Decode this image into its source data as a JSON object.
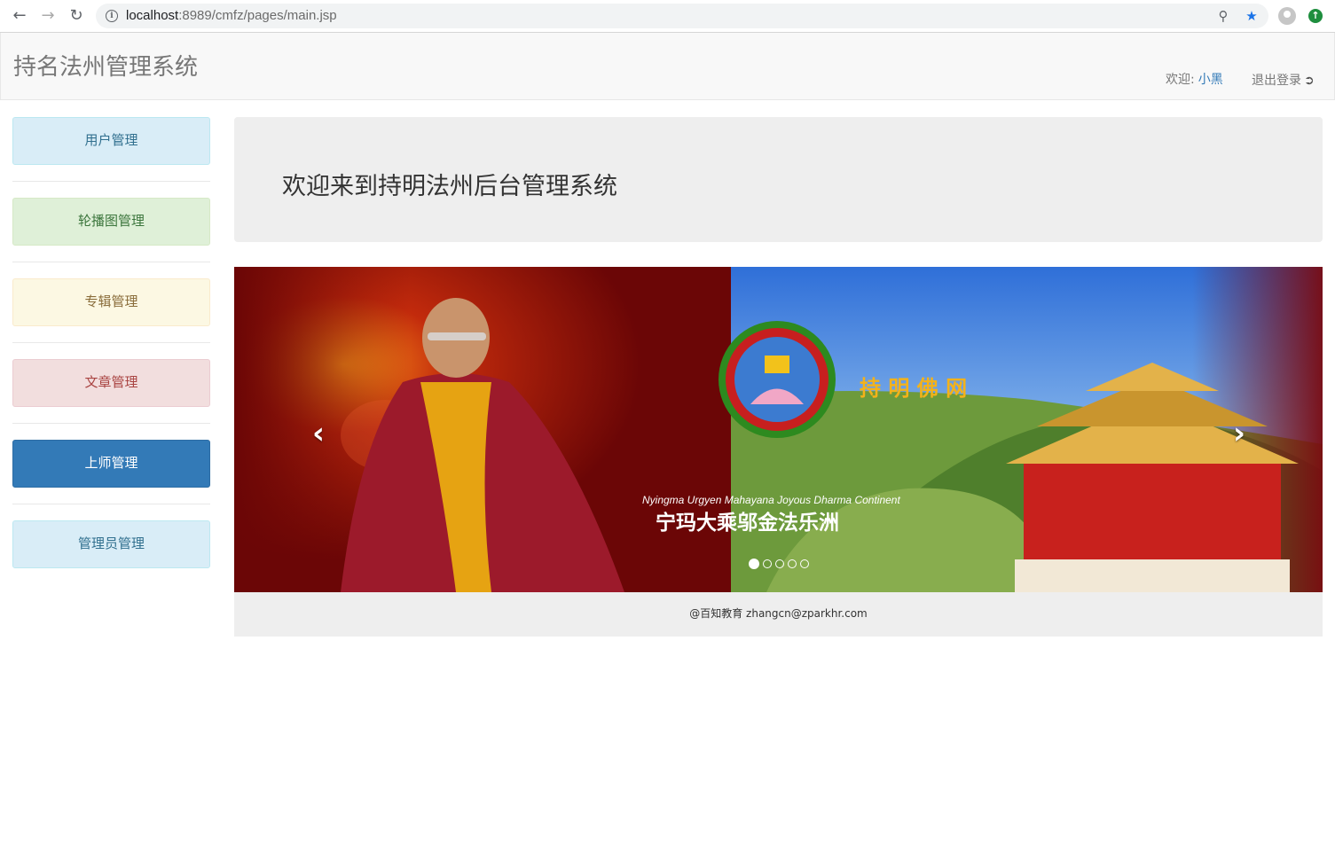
{
  "browser": {
    "url_host": "localhost",
    "url_path": ":8989/cmfz/pages/main.jsp",
    "back_icon": "back-arrow-icon",
    "forward_icon": "forward-arrow-icon",
    "reload_icon": "reload-icon"
  },
  "navbar": {
    "brand": "持名法州管理系统",
    "welcome_label": "欢迎:",
    "username": "小黑",
    "logout_label": "退出登录"
  },
  "sidebar": {
    "items": [
      {
        "label": "用户管理",
        "color": "#d9edf7"
      },
      {
        "label": "轮播图管理",
        "color": "#dff0d8"
      },
      {
        "label": "专辑管理",
        "color": "#fcf8e3"
      },
      {
        "label": "文章管理",
        "color": "#f2dede"
      },
      {
        "label": "上师管理",
        "color": "#337ab7"
      },
      {
        "label": "管理员管理",
        "color": "#d9edf7"
      }
    ]
  },
  "jumbotron": {
    "title": "欢迎来到持明法州后台管理系统"
  },
  "carousel": {
    "banner": {
      "brand_text": "持 明 佛 网",
      "english_text": "Nyingma Urgyen Mahayana Joyous Dharma Continent",
      "chinese_text": "宁玛大乘邬金法乐洲"
    },
    "slide_count": 5,
    "active_index": 0,
    "prev_icon": "chevron-left-icon",
    "next_icon": "chevron-right-icon"
  },
  "footer": {
    "text": "@百知教育 zhangcn@zparkhr.com"
  }
}
